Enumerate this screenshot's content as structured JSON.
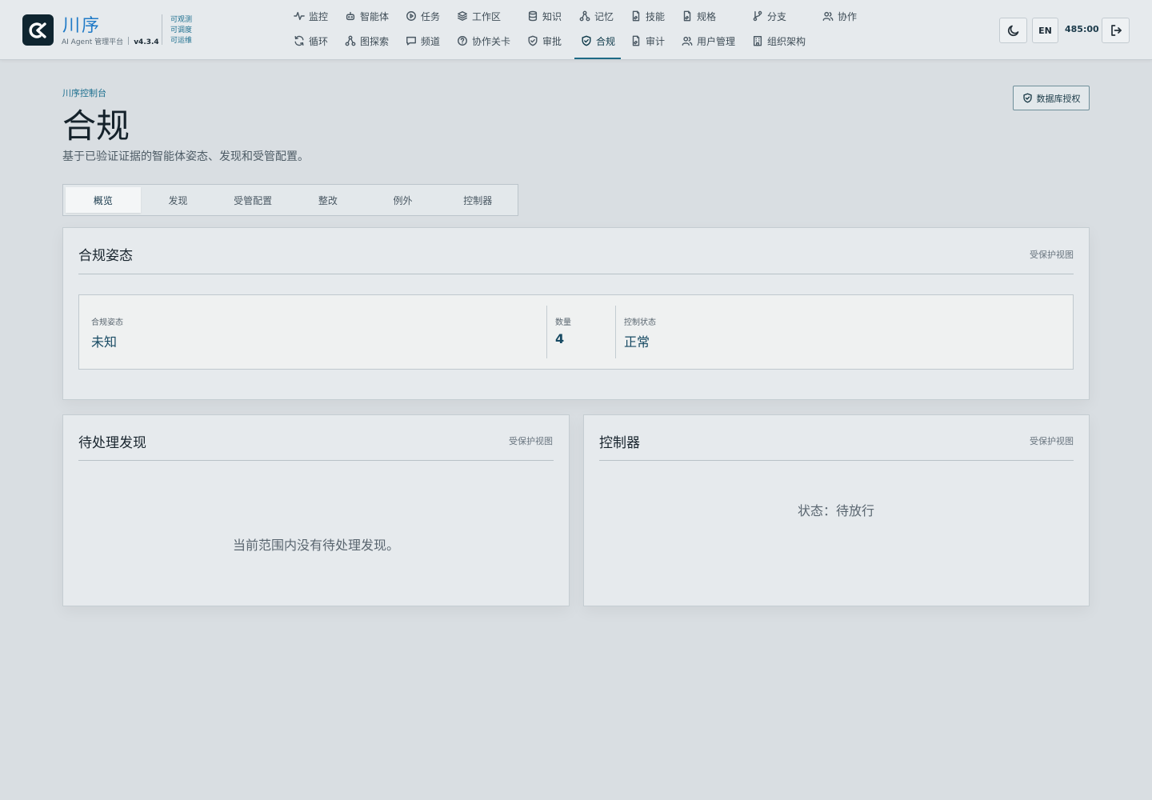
{
  "brand": {
    "name": "川序",
    "subtitle": "AI Agent 管理平台",
    "version": "v4.3.4",
    "taglines": [
      "可观测",
      "可调度",
      "可运维"
    ]
  },
  "nav": {
    "row1": [
      {
        "label": "监控",
        "icon": "activity-icon"
      },
      {
        "label": "智能体",
        "icon": "robot-icon"
      },
      {
        "label": "任务",
        "icon": "play-circle-icon"
      },
      {
        "label": "工作区",
        "icon": "layers-icon"
      },
      {
        "label": "知识",
        "icon": "database-icon"
      },
      {
        "label": "记忆",
        "icon": "network-icon"
      },
      {
        "label": "技能",
        "icon": "file-sign-icon"
      },
      {
        "label": "规格",
        "icon": "file-sign-icon"
      },
      {
        "label": "分支",
        "icon": "git-branch-icon"
      },
      {
        "label": "协作",
        "icon": "users-icon"
      }
    ],
    "row2": [
      {
        "label": "循环",
        "icon": "refresh-icon"
      },
      {
        "label": "图探索",
        "icon": "network-icon"
      },
      {
        "label": "频道",
        "icon": "message-icon"
      },
      {
        "label": "协作关卡",
        "icon": "help-circle-icon"
      },
      {
        "label": "审批",
        "icon": "shield-check-icon"
      },
      {
        "label": "合规",
        "icon": "shield-check-icon",
        "active": true
      },
      {
        "label": "审计",
        "icon": "file-sign-icon"
      },
      {
        "label": "用户管理",
        "icon": "users-icon"
      },
      {
        "label": "组织架构",
        "icon": "building-icon"
      }
    ]
  },
  "actions": {
    "theme_icon": "moon-icon",
    "lang": "EN",
    "timer": "485:00",
    "logout_icon": "logout-icon"
  },
  "header": {
    "breadcrumb": "川序控制台",
    "title": "合规",
    "subtitle": "基于已验证证据的智能体姿态、发现和受管配置。",
    "db_button": "数据库授权"
  },
  "tabs": [
    {
      "label": "概览",
      "active": true
    },
    {
      "label": "发现"
    },
    {
      "label": "受管配置"
    },
    {
      "label": "整改"
    },
    {
      "label": "例外"
    },
    {
      "label": "控制器"
    }
  ],
  "posture": {
    "title": "合规姿态",
    "tag": "受保护视图",
    "metrics": [
      {
        "label": "合规姿态",
        "value": "未知"
      },
      {
        "label": "数量",
        "value": "4"
      },
      {
        "label": "控制状态",
        "value": "正常"
      }
    ]
  },
  "findings": {
    "title": "待处理发现",
    "tag": "受保护视图",
    "empty": "当前范围内没有待处理发现。"
  },
  "controller": {
    "title": "控制器",
    "tag": "受保护视图",
    "status": "状态：待放行"
  }
}
